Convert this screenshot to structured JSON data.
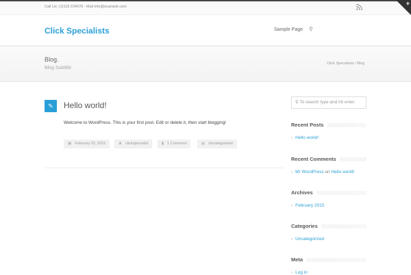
{
  "topbar": {
    "contact": "Call Us: (1)118 234678 - Mail info@example.com",
    "rss_icon": "rss-icon",
    "corner": "+"
  },
  "header": {
    "logo": "Click Specialists",
    "nav": [
      "Sample Page"
    ],
    "search_icon": "search-icon"
  },
  "banner": {
    "title": "Blog.",
    "subtitle": "Blog Subtitle",
    "breadcrumb": "Click Specialists / Blog"
  },
  "post": {
    "icon": "pencil-icon",
    "title": "Hello world!",
    "body": "Welcome to WordPress. This is your first post. Edit or delete it, then start blogging!",
    "meta": {
      "date": "February 22, 2015",
      "author": "clickspecialist",
      "comments": "1 Comment",
      "category": "Uncategorized"
    }
  },
  "sidebar": {
    "search_placeholder": "To search type and hit enter",
    "recent_posts": {
      "title": "Recent Posts",
      "items": [
        "Hello world!"
      ]
    },
    "recent_comments": {
      "title": "Recent Comments",
      "author": "Mr WordPress",
      "on": "on",
      "post": "Hello world!"
    },
    "archives": {
      "title": "Archives",
      "items": [
        "February 2015"
      ]
    },
    "categories": {
      "title": "Categories",
      "items": [
        "Uncategorized"
      ]
    },
    "meta": {
      "title": "Meta",
      "items": [
        "Log in"
      ]
    }
  },
  "colors": {
    "accent": "#2a9fd6"
  }
}
